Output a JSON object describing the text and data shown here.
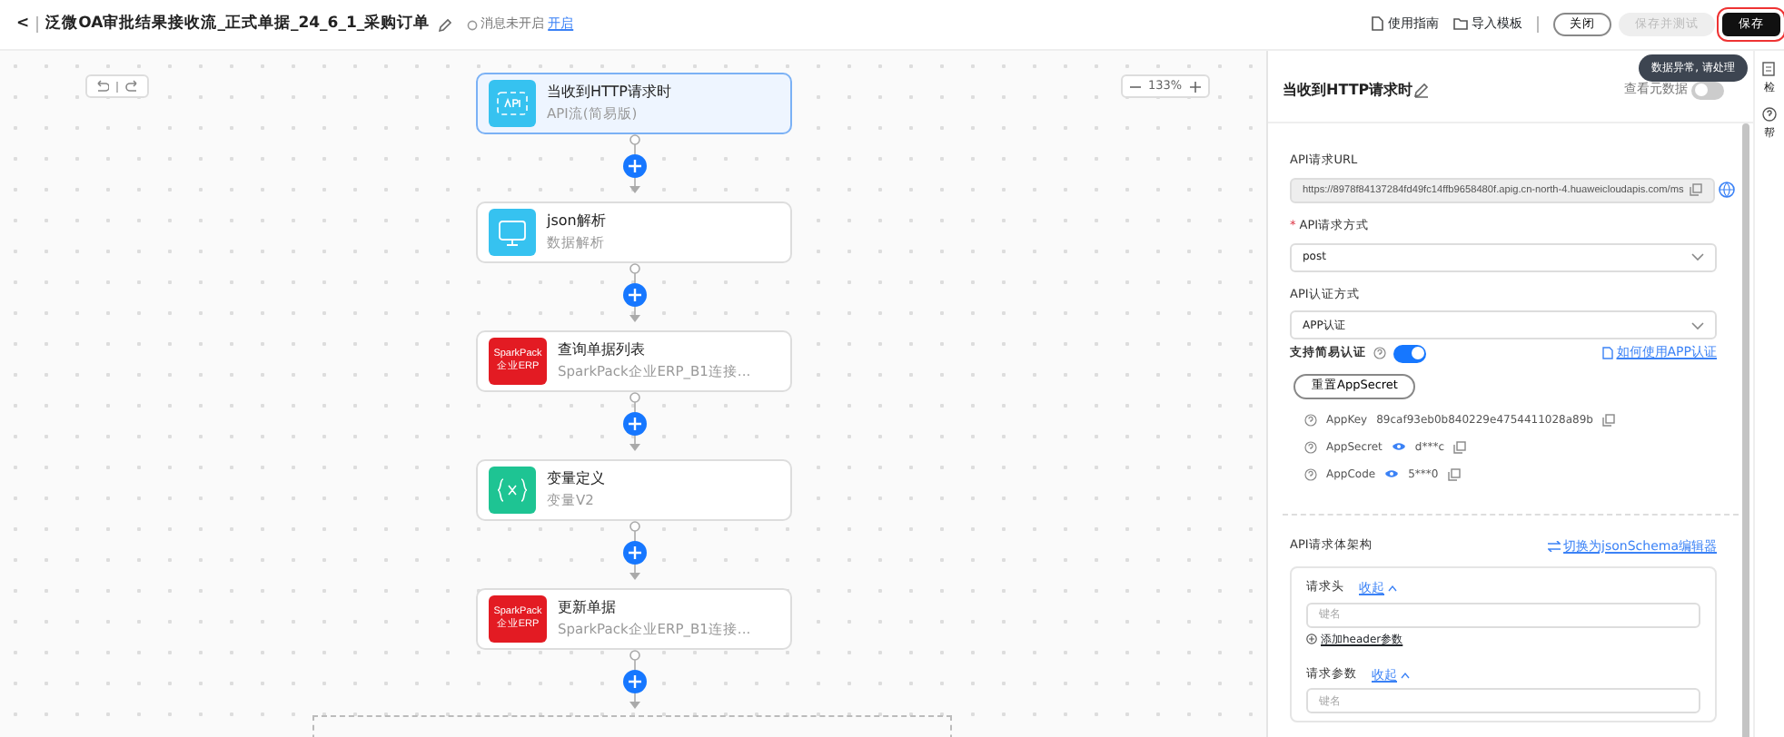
{
  "header": {
    "back": "<",
    "title": "泛微OA审批结果接收流_正式单据_24_6_1_采购订单",
    "status": "消息未开启",
    "status_link": "开启",
    "actions": [
      {
        "label": "使用指南",
        "kind": "doc"
      },
      {
        "label": "导入模板",
        "kind": "folder"
      }
    ],
    "close": "关闭",
    "save_test": {
      "label": "保存并测试",
      "disabled": true
    },
    "save": {
      "label": "保存",
      "highlighted": true
    }
  },
  "canvas": {
    "zoom": "133%",
    "nodes": [
      {
        "title": "当收到HTTP请求时",
        "subtitle": "API流(简易版)",
        "kind": "api",
        "selected": true
      },
      {
        "title": "json解析",
        "subtitle": "数据解析",
        "kind": "monitor",
        "selected": false
      },
      {
        "title": "查询单据列表",
        "subtitle": "SparkPack企业ERP_B1连接...",
        "kind": "sparkpack",
        "logo_text": [
          "SparkPack",
          "企业ERP"
        ],
        "selected": false
      },
      {
        "title": "变量定义",
        "subtitle": "变量V2",
        "kind": "variable",
        "selected": false
      },
      {
        "title": "更新单据",
        "subtitle": "SparkPack企业ERP_B1连接...",
        "kind": "sparkpack",
        "logo_text": [
          "SparkPack",
          "企业ERP"
        ],
        "selected": false
      }
    ]
  },
  "tooltip": "数据异常, 请处理",
  "panel": {
    "title": "当收到HTTP请求时",
    "metadata_label": "查看元数据",
    "metadata_on": false,
    "url": {
      "label": "API请求URL",
      "value": "https://8978f84137284fd49fc14ffb9658480f.apig.cn-north-4.huaweicloudapis.com/ms"
    },
    "method": {
      "label": "API请求方式",
      "required_mark": "*",
      "value": "post"
    },
    "auth": {
      "label": "API认证方式",
      "value": "APP认证"
    },
    "simple_auth": {
      "label": "支持简易认证",
      "on": true,
      "link": "如何使用APP认证"
    },
    "reset": "重置AppSecret",
    "keys": [
      {
        "name": "AppKey",
        "value": "89caf93eb0b840229e4754411028a89b",
        "masked": false
      },
      {
        "name": "AppSecret",
        "value": "d***c",
        "masked": true
      },
      {
        "name": "AppCode",
        "value": "5***0",
        "masked": true
      }
    ],
    "body": {
      "label": "API请求体架构",
      "switch_link": "切换为jsonSchema编辑器",
      "sections": [
        {
          "label": "请求头",
          "toggle": "收起",
          "placeholder": "键名",
          "add": "添加header参数"
        },
        {
          "label": "请求参数",
          "toggle": "收起",
          "placeholder": "键名"
        }
      ]
    }
  },
  "side_strip": [
    "检",
    "帮"
  ]
}
